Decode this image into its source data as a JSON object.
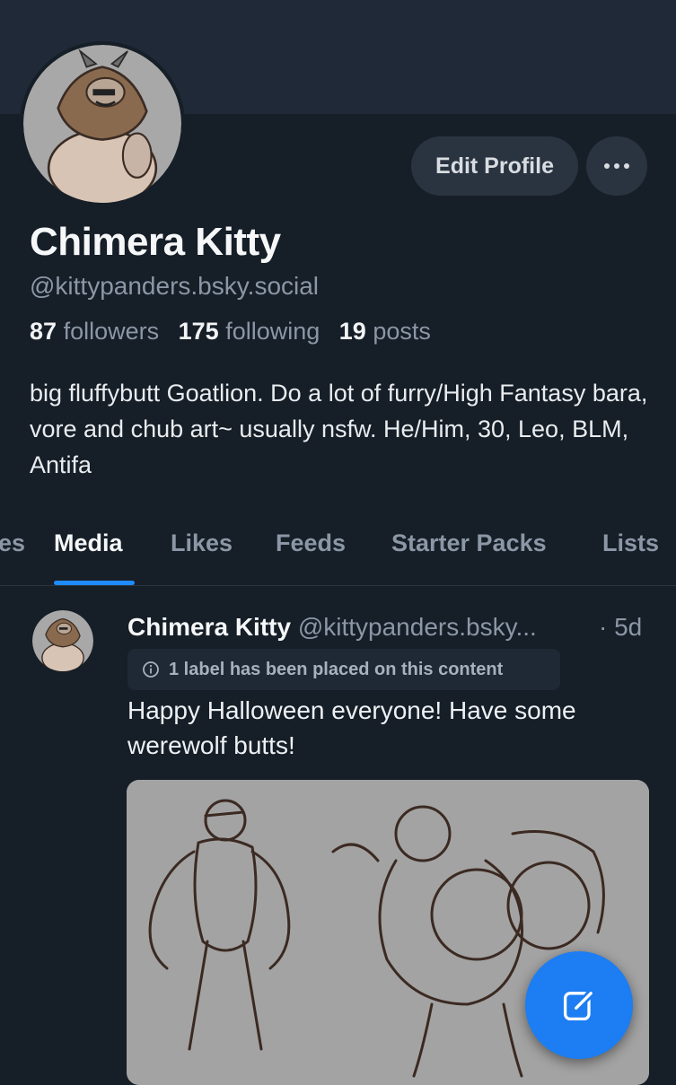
{
  "profile": {
    "display_name": "Chimera Kitty",
    "handle": "@kittypanders.bsky.social",
    "followers_count": "87",
    "followers_label": "followers",
    "following_count": "175",
    "following_label": "following",
    "posts_count": "19",
    "posts_label": "posts",
    "bio": "big fluffybutt Goatlion. Do a lot of furry/High Fantasy bara, vore and chub art~ usually nsfw. He/Him, 30, Leo, BLM,  Antifa"
  },
  "actions": {
    "edit_profile_label": "Edit Profile",
    "more_icon": "ellipsis-icon"
  },
  "tabs": [
    {
      "label": "es",
      "active": false
    },
    {
      "label": "Media",
      "active": true
    },
    {
      "label": "Likes",
      "active": false
    },
    {
      "label": "Feeds",
      "active": false
    },
    {
      "label": "Starter Packs",
      "active": false
    },
    {
      "label": "Lists",
      "active": false
    }
  ],
  "post": {
    "author_name": "Chimera Kitty",
    "author_handle": "@kittypanders.bsky...",
    "time": "· 5d",
    "label_notice": "1 label has been placed on this content",
    "text": "Happy Halloween everyone! Have some werewolf butts!"
  },
  "colors": {
    "background": "#161e27",
    "banner": "#1f2937",
    "accent": "#208bfe",
    "muted_text": "#8b97a6"
  },
  "icons": {
    "compose": "compose-icon",
    "info": "info-icon"
  }
}
